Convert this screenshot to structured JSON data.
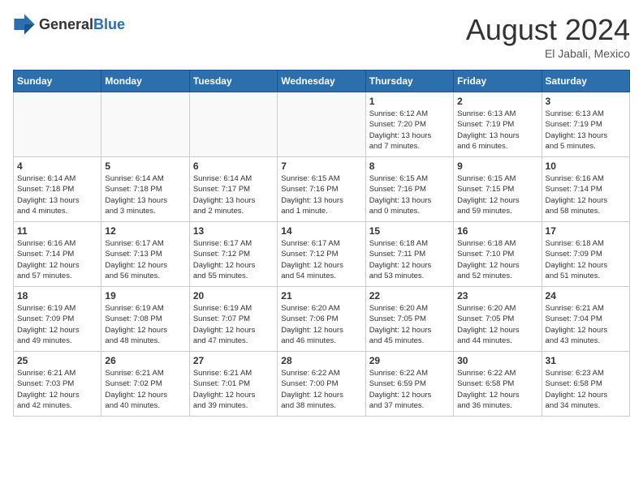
{
  "header": {
    "logo": {
      "general": "General",
      "blue": "Blue"
    },
    "title": "August 2024",
    "location": "El Jabali, Mexico"
  },
  "calendar": {
    "weekdays": [
      "Sunday",
      "Monday",
      "Tuesday",
      "Wednesday",
      "Thursday",
      "Friday",
      "Saturday"
    ],
    "weeks": [
      [
        {
          "day": "",
          "info": ""
        },
        {
          "day": "",
          "info": ""
        },
        {
          "day": "",
          "info": ""
        },
        {
          "day": "",
          "info": ""
        },
        {
          "day": "1",
          "info": "Sunrise: 6:12 AM\nSunset: 7:20 PM\nDaylight: 13 hours\nand 7 minutes."
        },
        {
          "day": "2",
          "info": "Sunrise: 6:13 AM\nSunset: 7:19 PM\nDaylight: 13 hours\nand 6 minutes."
        },
        {
          "day": "3",
          "info": "Sunrise: 6:13 AM\nSunset: 7:19 PM\nDaylight: 13 hours\nand 5 minutes."
        }
      ],
      [
        {
          "day": "4",
          "info": "Sunrise: 6:14 AM\nSunset: 7:18 PM\nDaylight: 13 hours\nand 4 minutes."
        },
        {
          "day": "5",
          "info": "Sunrise: 6:14 AM\nSunset: 7:18 PM\nDaylight: 13 hours\nand 3 minutes."
        },
        {
          "day": "6",
          "info": "Sunrise: 6:14 AM\nSunset: 7:17 PM\nDaylight: 13 hours\nand 2 minutes."
        },
        {
          "day": "7",
          "info": "Sunrise: 6:15 AM\nSunset: 7:16 PM\nDaylight: 13 hours\nand 1 minute."
        },
        {
          "day": "8",
          "info": "Sunrise: 6:15 AM\nSunset: 7:16 PM\nDaylight: 13 hours\nand 0 minutes."
        },
        {
          "day": "9",
          "info": "Sunrise: 6:15 AM\nSunset: 7:15 PM\nDaylight: 12 hours\nand 59 minutes."
        },
        {
          "day": "10",
          "info": "Sunrise: 6:16 AM\nSunset: 7:14 PM\nDaylight: 12 hours\nand 58 minutes."
        }
      ],
      [
        {
          "day": "11",
          "info": "Sunrise: 6:16 AM\nSunset: 7:14 PM\nDaylight: 12 hours\nand 57 minutes."
        },
        {
          "day": "12",
          "info": "Sunrise: 6:17 AM\nSunset: 7:13 PM\nDaylight: 12 hours\nand 56 minutes."
        },
        {
          "day": "13",
          "info": "Sunrise: 6:17 AM\nSunset: 7:12 PM\nDaylight: 12 hours\nand 55 minutes."
        },
        {
          "day": "14",
          "info": "Sunrise: 6:17 AM\nSunset: 7:12 PM\nDaylight: 12 hours\nand 54 minutes."
        },
        {
          "day": "15",
          "info": "Sunrise: 6:18 AM\nSunset: 7:11 PM\nDaylight: 12 hours\nand 53 minutes."
        },
        {
          "day": "16",
          "info": "Sunrise: 6:18 AM\nSunset: 7:10 PM\nDaylight: 12 hours\nand 52 minutes."
        },
        {
          "day": "17",
          "info": "Sunrise: 6:18 AM\nSunset: 7:09 PM\nDaylight: 12 hours\nand 51 minutes."
        }
      ],
      [
        {
          "day": "18",
          "info": "Sunrise: 6:19 AM\nSunset: 7:09 PM\nDaylight: 12 hours\nand 49 minutes."
        },
        {
          "day": "19",
          "info": "Sunrise: 6:19 AM\nSunset: 7:08 PM\nDaylight: 12 hours\nand 48 minutes."
        },
        {
          "day": "20",
          "info": "Sunrise: 6:19 AM\nSunset: 7:07 PM\nDaylight: 12 hours\nand 47 minutes."
        },
        {
          "day": "21",
          "info": "Sunrise: 6:20 AM\nSunset: 7:06 PM\nDaylight: 12 hours\nand 46 minutes."
        },
        {
          "day": "22",
          "info": "Sunrise: 6:20 AM\nSunset: 7:05 PM\nDaylight: 12 hours\nand 45 minutes."
        },
        {
          "day": "23",
          "info": "Sunrise: 6:20 AM\nSunset: 7:05 PM\nDaylight: 12 hours\nand 44 minutes."
        },
        {
          "day": "24",
          "info": "Sunrise: 6:21 AM\nSunset: 7:04 PM\nDaylight: 12 hours\nand 43 minutes."
        }
      ],
      [
        {
          "day": "25",
          "info": "Sunrise: 6:21 AM\nSunset: 7:03 PM\nDaylight: 12 hours\nand 42 minutes."
        },
        {
          "day": "26",
          "info": "Sunrise: 6:21 AM\nSunset: 7:02 PM\nDaylight: 12 hours\nand 40 minutes."
        },
        {
          "day": "27",
          "info": "Sunrise: 6:21 AM\nSunset: 7:01 PM\nDaylight: 12 hours\nand 39 minutes."
        },
        {
          "day": "28",
          "info": "Sunrise: 6:22 AM\nSunset: 7:00 PM\nDaylight: 12 hours\nand 38 minutes."
        },
        {
          "day": "29",
          "info": "Sunrise: 6:22 AM\nSunset: 6:59 PM\nDaylight: 12 hours\nand 37 minutes."
        },
        {
          "day": "30",
          "info": "Sunrise: 6:22 AM\nSunset: 6:58 PM\nDaylight: 12 hours\nand 36 minutes."
        },
        {
          "day": "31",
          "info": "Sunrise: 6:23 AM\nSunset: 6:58 PM\nDaylight: 12 hours\nand 34 minutes."
        }
      ]
    ]
  }
}
